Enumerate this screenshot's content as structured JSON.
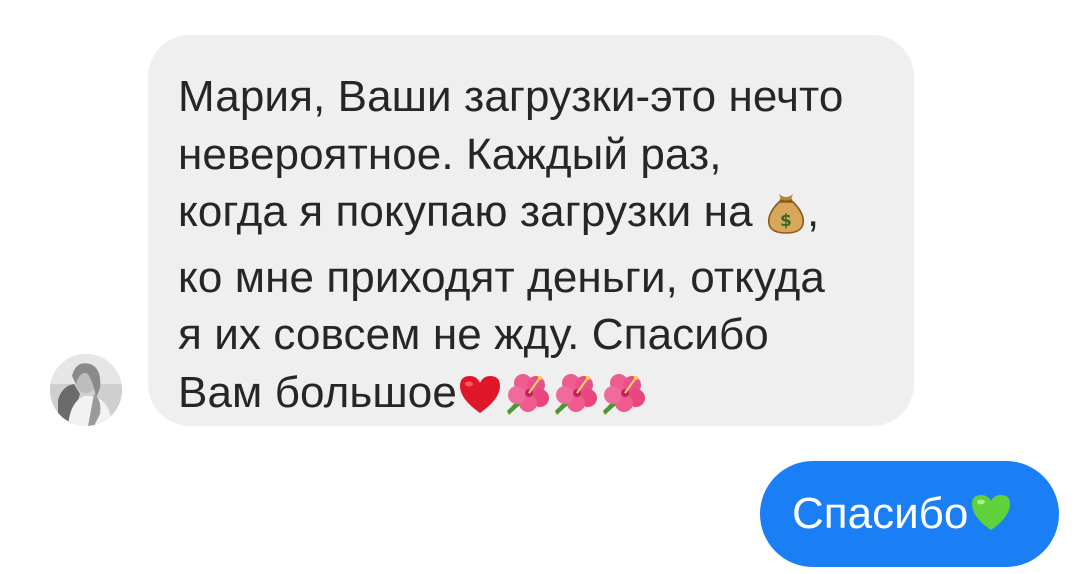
{
  "incoming_message": {
    "lines": [
      "Мария, Ваши загрузки-это нечто",
      "невероятное. Каждый раз,",
      "когда я покупаю загрузки на ",
      ",",
      "ко мне приходят деньги, откуда",
      "я их совсем не жду.  Спасибо",
      "Вам большое"
    ],
    "inline_emoji": "money-bag-icon",
    "trailing_emojis": [
      "red-heart-icon",
      "hibiscus-icon",
      "hibiscus-icon",
      "hibiscus-icon"
    ],
    "bubble_color": "#efefef",
    "text_color": "#262626"
  },
  "outgoing_message": {
    "text": "Спасибо",
    "trailing_emoji": "green-heart-icon",
    "bubble_color": "#1a7ff5",
    "text_color": "#ffffff"
  },
  "sender": {
    "avatar": "avatar"
  }
}
